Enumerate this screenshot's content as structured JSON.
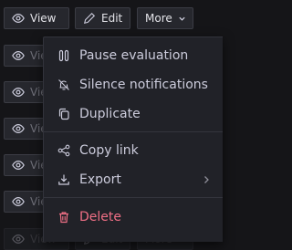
{
  "toolbar": {
    "view_label": "View",
    "edit_label": "Edit",
    "more_label": "More"
  },
  "rows": [
    {
      "view_label": "View"
    },
    {
      "view_label": "View"
    },
    {
      "view_label": "View"
    },
    {
      "view_label": "View"
    },
    {
      "view_label": "View"
    },
    {
      "view_label": "View",
      "edit_label": "Edit",
      "more_label": "More"
    }
  ],
  "menu": {
    "items": [
      {
        "label": "Pause evaluation",
        "icon": "pause-icon"
      },
      {
        "label": "Silence notifications",
        "icon": "bell-slash-icon"
      },
      {
        "label": "Duplicate",
        "icon": "copy-icon"
      },
      {
        "label": "Copy link",
        "icon": "share-icon"
      },
      {
        "label": "Export",
        "icon": "download-icon",
        "submenu": true
      },
      {
        "label": "Delete",
        "icon": "trash-icon",
        "danger": true
      }
    ]
  },
  "colors": {
    "background": "#151518",
    "button": "#26272d",
    "menu": "#212228",
    "danger": "#ef6f85"
  }
}
